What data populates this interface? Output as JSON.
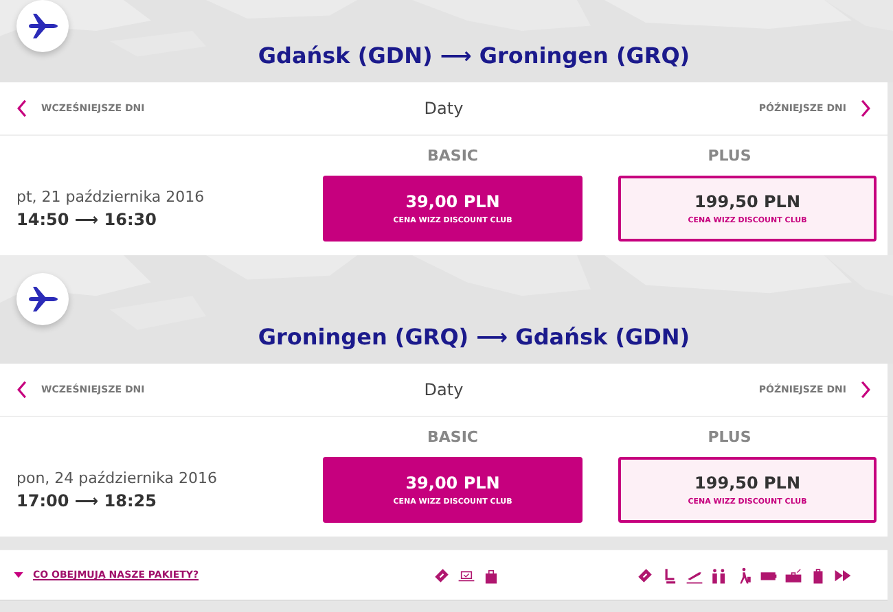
{
  "flights": [
    {
      "route": "Gdańsk (GDN) ⟶ Groningen (GRQ)",
      "nav": {
        "earlier": "WCZEŚNIEJSZE DNI",
        "center": "Daty",
        "later": "PÓŹNIEJSZE DNI"
      },
      "columns": [
        "BASIC",
        "PLUS"
      ],
      "date": "pt, 21 października 2016",
      "times": "14:50 ⟶ 16:30",
      "fares": [
        {
          "price": "39,00 PLN",
          "note": "CENA WIZZ DISCOUNT CLUB",
          "selected": true
        },
        {
          "price": "199,50 PLN",
          "note": "CENA WIZZ DISCOUNT CLUB",
          "selected": false
        }
      ]
    },
    {
      "route": "Groningen (GRQ) ⟶ Gdańsk (GDN)",
      "nav": {
        "earlier": "WCZEŚNIEJSZE DNI",
        "center": "Daty",
        "later": "PÓŹNIEJSZE DNI"
      },
      "columns": [
        "BASIC",
        "PLUS"
      ],
      "date": "pon, 24 października 2016",
      "times": "17:00 ⟶ 18:25",
      "fares": [
        {
          "price": "39,00 PLN",
          "note": "CENA WIZZ DISCOUNT CLUB",
          "selected": true
        },
        {
          "price": "199,50 PLN",
          "note": "CENA WIZZ DISCOUNT CLUB",
          "selected": false
        }
      ]
    }
  ],
  "footer": {
    "link": "CO OBEJMUJĄ NASZE PAKIETY?"
  }
}
